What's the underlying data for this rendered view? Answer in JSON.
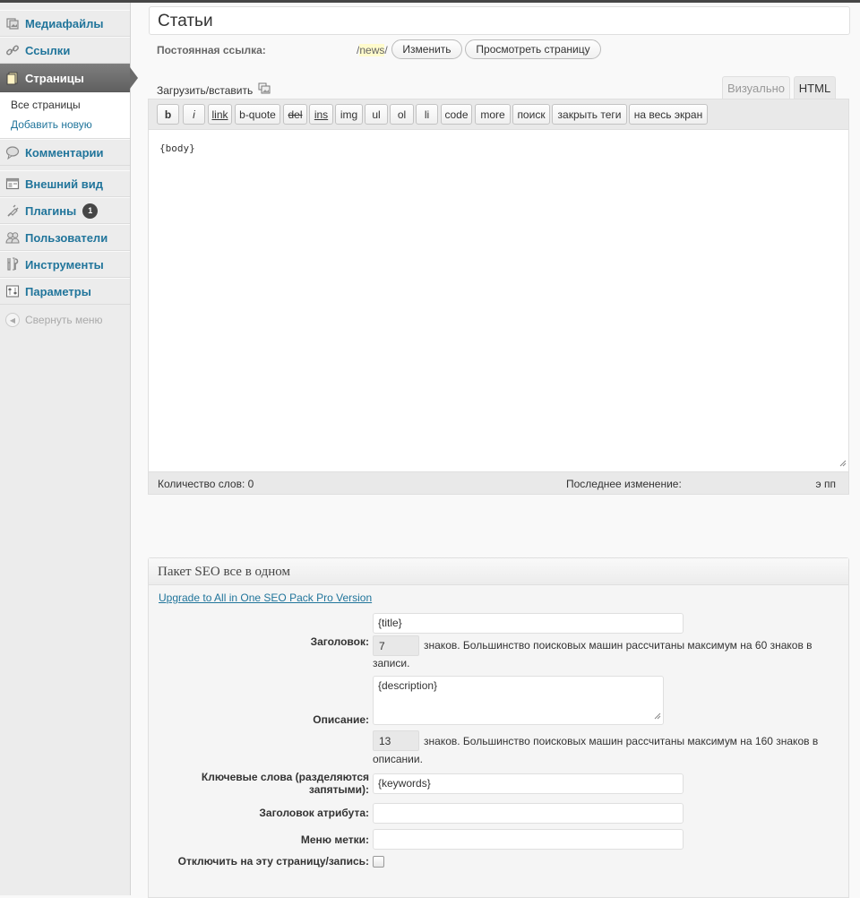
{
  "sidebar": {
    "items": [
      {
        "label": "Медиафайлы",
        "icon": "media-icon"
      },
      {
        "label": "Ссылки",
        "icon": "links-icon"
      },
      {
        "label": "Страницы",
        "icon": "pages-icon",
        "current": true
      },
      {
        "label": "Комментарии",
        "icon": "comments-icon"
      },
      {
        "label": "Внешний вид",
        "icon": "appearance-icon"
      },
      {
        "label": "Плагины",
        "icon": "plugins-icon",
        "badge": "1"
      },
      {
        "label": "Пользователи",
        "icon": "users-icon"
      },
      {
        "label": "Инструменты",
        "icon": "tools-icon"
      },
      {
        "label": "Параметры",
        "icon": "settings-icon"
      }
    ],
    "submenu": [
      "Все страницы",
      "Добавить новую"
    ],
    "collapse_label": "Свернуть меню"
  },
  "editor": {
    "title": "Статьи",
    "permalink_label": "Постоянная ссылка:",
    "permalink_prefix": "/",
    "permalink_slug": "news",
    "permalink_suffix": "/",
    "edit_button": "Изменить",
    "view_button": "Просмотреть страницу",
    "upload_label": "Загрузить/вставить",
    "tabs": {
      "visual": "Визуально",
      "html": "HTML"
    },
    "toolbar": [
      "b",
      "i",
      "link",
      "b-quote",
      "del",
      "ins",
      "img",
      "ul",
      "ol",
      "li",
      "code",
      "more",
      "поиск",
      "закрыть теги",
      "на весь экран"
    ],
    "content": "{body}",
    "word_count": "Количество слов: 0",
    "last_modified_label": "Последнее изменение:",
    "last_modified_value": "э пп"
  },
  "seo": {
    "header": "Пакет SEO все в одном",
    "upgrade_link": "Upgrade to All in One SEO Pack Pro Version",
    "title_label": "Заголовок:",
    "title_value": "{title}",
    "title_count": "7",
    "title_hint_1": "знаков. Большинство поисковых машин рассчитаны максимум на 60 знаков в",
    "title_hint_2": "записи.",
    "desc_label": "Описание:",
    "desc_value": "{description}",
    "desc_count": "13",
    "desc_hint_1": "знаков. Большинство поисковых машин рассчитаны максимум на 160 знаков в",
    "desc_hint_2": "описании.",
    "keywords_label_1": "Ключевые слова (разделяются",
    "keywords_label_2": "запятыми):",
    "keywords_value": "{keywords}",
    "attr_title_label": "Заголовок атрибута:",
    "menu_label": "Меню метки:",
    "disable_label": "Отключить на эту страницу/запись:"
  },
  "colors": {
    "link": "#21759b",
    "menu_current": "#6b6b6b",
    "highlight": "#fffbcc"
  }
}
